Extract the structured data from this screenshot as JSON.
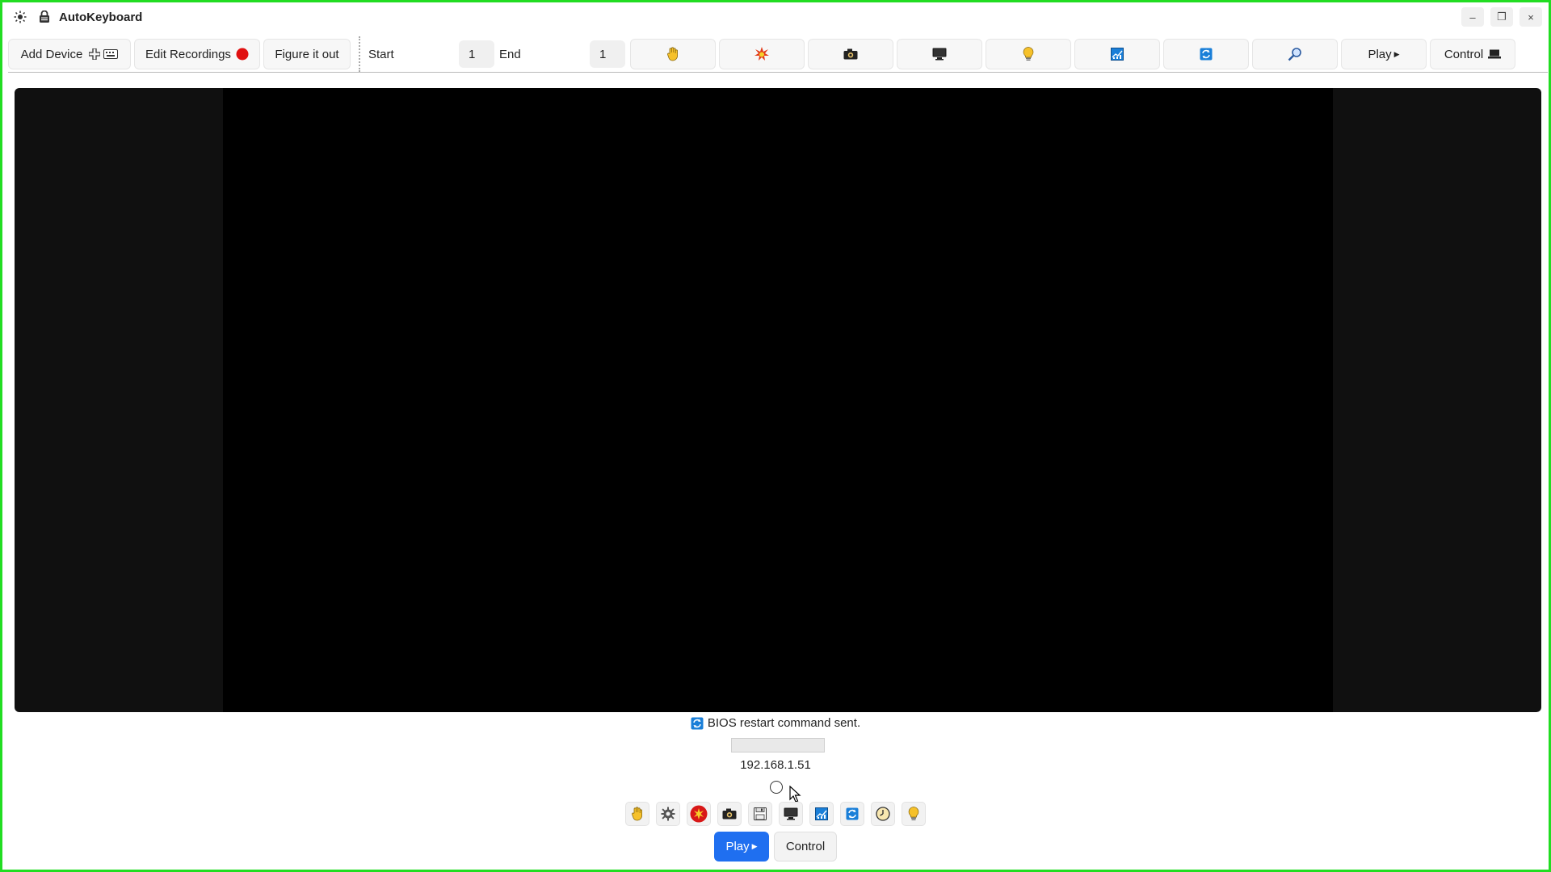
{
  "window": {
    "title": "AutoKeyboard",
    "minimize_glyph": "–",
    "restore_glyph": "❐",
    "close_glyph": "×"
  },
  "toolbar": {
    "add_device_label": "Add Device",
    "edit_recordings_label": "Edit Recordings",
    "figure_it_out_label": "Figure it out",
    "start_label": "Start",
    "start_value": "1",
    "end_label": "End",
    "end_value": "1",
    "play_label": "Play",
    "control_label": "Control",
    "icon_buttons": [
      "hand-icon",
      "burst-icon",
      "camera-icon",
      "monitor-icon",
      "lightbulb-icon",
      "chart-icon",
      "refresh-icon",
      "search-icon"
    ]
  },
  "status": {
    "message": "BIOS restart command sent.",
    "progress_fraction": 0,
    "ip_address": "192.168.1.51"
  },
  "bottom": {
    "icons": [
      "hand-icon",
      "gear-icon",
      "record-stop-icon",
      "camera-icon",
      "save-icon",
      "monitor-icon",
      "chart-icon",
      "refresh-icon",
      "clock-icon",
      "lightbulb-icon"
    ],
    "play_label": "Play",
    "control_label": "Control"
  },
  "colors": {
    "window_border": "#22dd22",
    "primary_button": "#1f6ff0",
    "record_red": "#e01010",
    "viewport_bg": "#000000"
  }
}
